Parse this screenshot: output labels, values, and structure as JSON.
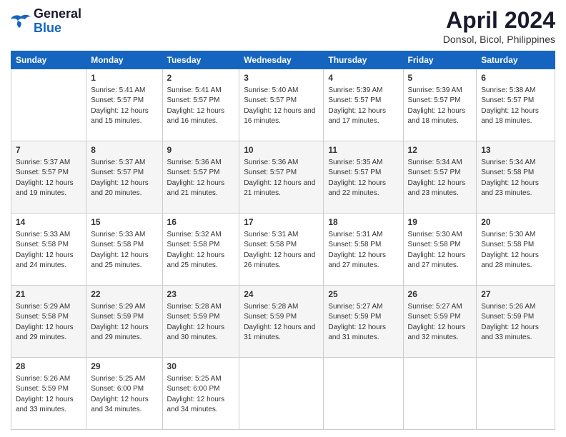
{
  "header": {
    "logo_line1": "General",
    "logo_line2": "Blue",
    "title": "April 2024",
    "subtitle": "Donsol, Bicol, Philippines"
  },
  "columns": [
    "Sunday",
    "Monday",
    "Tuesday",
    "Wednesday",
    "Thursday",
    "Friday",
    "Saturday"
  ],
  "weeks": [
    [
      {
        "day": "",
        "sunrise": "",
        "sunset": "",
        "daylight": ""
      },
      {
        "day": "1",
        "sunrise": "Sunrise: 5:41 AM",
        "sunset": "Sunset: 5:57 PM",
        "daylight": "Daylight: 12 hours and 15 minutes."
      },
      {
        "day": "2",
        "sunrise": "Sunrise: 5:41 AM",
        "sunset": "Sunset: 5:57 PM",
        "daylight": "Daylight: 12 hours and 16 minutes."
      },
      {
        "day": "3",
        "sunrise": "Sunrise: 5:40 AM",
        "sunset": "Sunset: 5:57 PM",
        "daylight": "Daylight: 12 hours and 16 minutes."
      },
      {
        "day": "4",
        "sunrise": "Sunrise: 5:39 AM",
        "sunset": "Sunset: 5:57 PM",
        "daylight": "Daylight: 12 hours and 17 minutes."
      },
      {
        "day": "5",
        "sunrise": "Sunrise: 5:39 AM",
        "sunset": "Sunset: 5:57 PM",
        "daylight": "Daylight: 12 hours and 18 minutes."
      },
      {
        "day": "6",
        "sunrise": "Sunrise: 5:38 AM",
        "sunset": "Sunset: 5:57 PM",
        "daylight": "Daylight: 12 hours and 18 minutes."
      }
    ],
    [
      {
        "day": "7",
        "sunrise": "Sunrise: 5:37 AM",
        "sunset": "Sunset: 5:57 PM",
        "daylight": "Daylight: 12 hours and 19 minutes."
      },
      {
        "day": "8",
        "sunrise": "Sunrise: 5:37 AM",
        "sunset": "Sunset: 5:57 PM",
        "daylight": "Daylight: 12 hours and 20 minutes."
      },
      {
        "day": "9",
        "sunrise": "Sunrise: 5:36 AM",
        "sunset": "Sunset: 5:57 PM",
        "daylight": "Daylight: 12 hours and 21 minutes."
      },
      {
        "day": "10",
        "sunrise": "Sunrise: 5:36 AM",
        "sunset": "Sunset: 5:57 PM",
        "daylight": "Daylight: 12 hours and 21 minutes."
      },
      {
        "day": "11",
        "sunrise": "Sunrise: 5:35 AM",
        "sunset": "Sunset: 5:57 PM",
        "daylight": "Daylight: 12 hours and 22 minutes."
      },
      {
        "day": "12",
        "sunrise": "Sunrise: 5:34 AM",
        "sunset": "Sunset: 5:57 PM",
        "daylight": "Daylight: 12 hours and 23 minutes."
      },
      {
        "day": "13",
        "sunrise": "Sunrise: 5:34 AM",
        "sunset": "Sunset: 5:58 PM",
        "daylight": "Daylight: 12 hours and 23 minutes."
      }
    ],
    [
      {
        "day": "14",
        "sunrise": "Sunrise: 5:33 AM",
        "sunset": "Sunset: 5:58 PM",
        "daylight": "Daylight: 12 hours and 24 minutes."
      },
      {
        "day": "15",
        "sunrise": "Sunrise: 5:33 AM",
        "sunset": "Sunset: 5:58 PM",
        "daylight": "Daylight: 12 hours and 25 minutes."
      },
      {
        "day": "16",
        "sunrise": "Sunrise: 5:32 AM",
        "sunset": "Sunset: 5:58 PM",
        "daylight": "Daylight: 12 hours and 25 minutes."
      },
      {
        "day": "17",
        "sunrise": "Sunrise: 5:31 AM",
        "sunset": "Sunset: 5:58 PM",
        "daylight": "Daylight: 12 hours and 26 minutes."
      },
      {
        "day": "18",
        "sunrise": "Sunrise: 5:31 AM",
        "sunset": "Sunset: 5:58 PM",
        "daylight": "Daylight: 12 hours and 27 minutes."
      },
      {
        "day": "19",
        "sunrise": "Sunrise: 5:30 AM",
        "sunset": "Sunset: 5:58 PM",
        "daylight": "Daylight: 12 hours and 27 minutes."
      },
      {
        "day": "20",
        "sunrise": "Sunrise: 5:30 AM",
        "sunset": "Sunset: 5:58 PM",
        "daylight": "Daylight: 12 hours and 28 minutes."
      }
    ],
    [
      {
        "day": "21",
        "sunrise": "Sunrise: 5:29 AM",
        "sunset": "Sunset: 5:58 PM",
        "daylight": "Daylight: 12 hours and 29 minutes."
      },
      {
        "day": "22",
        "sunrise": "Sunrise: 5:29 AM",
        "sunset": "Sunset: 5:59 PM",
        "daylight": "Daylight: 12 hours and 29 minutes."
      },
      {
        "day": "23",
        "sunrise": "Sunrise: 5:28 AM",
        "sunset": "Sunset: 5:59 PM",
        "daylight": "Daylight: 12 hours and 30 minutes."
      },
      {
        "day": "24",
        "sunrise": "Sunrise: 5:28 AM",
        "sunset": "Sunset: 5:59 PM",
        "daylight": "Daylight: 12 hours and 31 minutes."
      },
      {
        "day": "25",
        "sunrise": "Sunrise: 5:27 AM",
        "sunset": "Sunset: 5:59 PM",
        "daylight": "Daylight: 12 hours and 31 minutes."
      },
      {
        "day": "26",
        "sunrise": "Sunrise: 5:27 AM",
        "sunset": "Sunset: 5:59 PM",
        "daylight": "Daylight: 12 hours and 32 minutes."
      },
      {
        "day": "27",
        "sunrise": "Sunrise: 5:26 AM",
        "sunset": "Sunset: 5:59 PM",
        "daylight": "Daylight: 12 hours and 33 minutes."
      }
    ],
    [
      {
        "day": "28",
        "sunrise": "Sunrise: 5:26 AM",
        "sunset": "Sunset: 5:59 PM",
        "daylight": "Daylight: 12 hours and 33 minutes."
      },
      {
        "day": "29",
        "sunrise": "Sunrise: 5:25 AM",
        "sunset": "Sunset: 6:00 PM",
        "daylight": "Daylight: 12 hours and 34 minutes."
      },
      {
        "day": "30",
        "sunrise": "Sunrise: 5:25 AM",
        "sunset": "Sunset: 6:00 PM",
        "daylight": "Daylight: 12 hours and 34 minutes."
      },
      {
        "day": "",
        "sunrise": "",
        "sunset": "",
        "daylight": ""
      },
      {
        "day": "",
        "sunrise": "",
        "sunset": "",
        "daylight": ""
      },
      {
        "day": "",
        "sunrise": "",
        "sunset": "",
        "daylight": ""
      },
      {
        "day": "",
        "sunrise": "",
        "sunset": "",
        "daylight": ""
      }
    ]
  ]
}
